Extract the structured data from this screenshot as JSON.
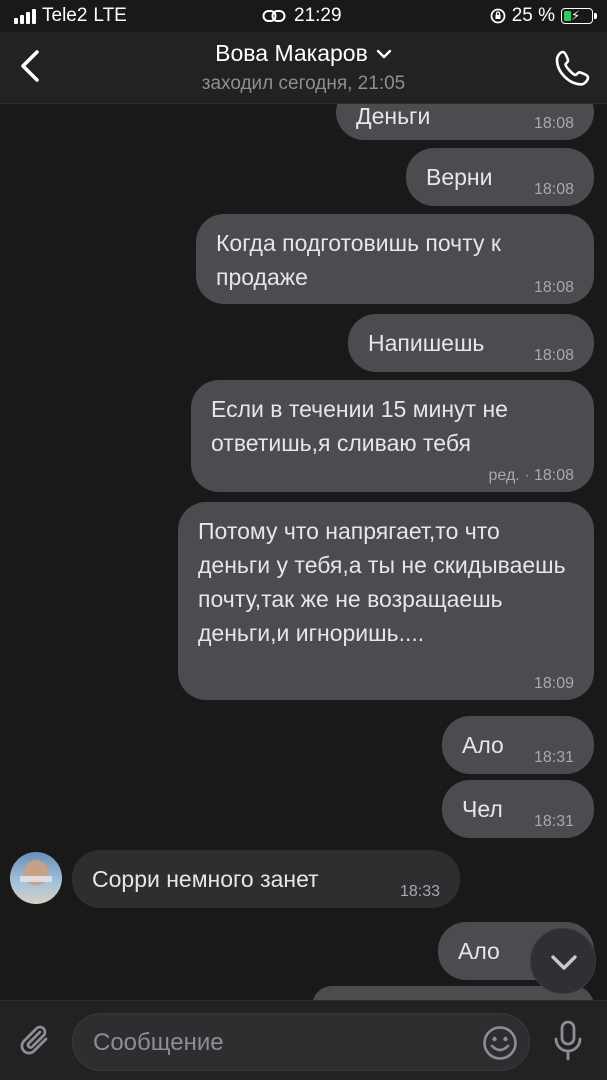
{
  "status_bar": {
    "carrier": "Tele2",
    "network": "LTE",
    "time": "21:29",
    "battery": "25 %",
    "battery_level": 0.25
  },
  "header": {
    "contact_name": "Вова Макаров",
    "last_seen": "заходил сегодня, 21:05"
  },
  "messages": [
    {
      "text": "Деньги",
      "time": "18:08",
      "direction": "out"
    },
    {
      "text": "Верни",
      "time": "18:08",
      "direction": "out"
    },
    {
      "text": "Когда подготовишь почту к продаже",
      "time": "18:08",
      "direction": "out"
    },
    {
      "text": "Напишешь",
      "time": "18:08",
      "direction": "out"
    },
    {
      "text": "Если в течении 15 минут не ответишь,я сливаю тебя",
      "time": "ред. · 18:08",
      "direction": "out"
    },
    {
      "text": "Потому что напрягает,то что деньги у тебя,а ты не скидываешь почту,так же не возращаешь деньги,и игноришь....",
      "time": "18:09",
      "direction": "out"
    },
    {
      "text": "Ало",
      "time": "18:31",
      "direction": "out"
    },
    {
      "text": "Чел",
      "time": "18:31",
      "direction": "out"
    },
    {
      "text": "Сорри немного занет",
      "time": "18:33",
      "direction": "in"
    },
    {
      "text": "Ало",
      "time": "",
      "direction": "out"
    }
  ],
  "composer": {
    "placeholder": "Сообщение"
  },
  "colors": {
    "background": "#19191a",
    "bubble_out": "#4b4c4f",
    "bubble_in": "#2d2e30",
    "header": "#222223",
    "battery_fill": "#34c759"
  },
  "icons": [
    "signal-icon",
    "link-icon",
    "orientation-lock-icon",
    "battery-icon",
    "back-icon",
    "chevron-down-icon",
    "phone-icon",
    "attach-icon",
    "emoji-icon",
    "mic-icon",
    "scroll-down-icon"
  ]
}
